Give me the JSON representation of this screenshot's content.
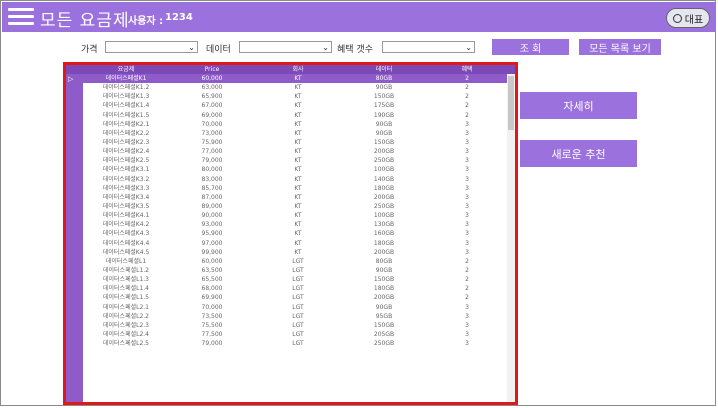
{
  "header": {
    "title": "모든 요금제",
    "user_label": "사용자 :",
    "user_value": "1234",
    "rep_button": "대표",
    "menu_icon": "hamburger-menu-icon"
  },
  "filters": {
    "price_label": "가격",
    "data_label": "데이터",
    "benefit_label": "혜택 갯수",
    "price_value": "",
    "data_value": "",
    "benefit_value": ""
  },
  "buttons": {
    "search": "조 회",
    "view_all": "모든 목록 보기",
    "detail": "자세히",
    "recommend": "새로운 추천"
  },
  "grid": {
    "columns": [
      "요금제",
      "Price",
      "회사",
      "데이터",
      "혜택"
    ],
    "rows": [
      [
        "데이터스페셜K1",
        "60,000",
        "KT",
        "80GB",
        "2"
      ],
      [
        "데이터스페셜K1.2",
        "63,000",
        "KT",
        "90GB",
        "2"
      ],
      [
        "데이터스페셜K1.3",
        "65,900",
        "KT",
        "150GB",
        "2"
      ],
      [
        "데이터스페셜K1.4",
        "67,000",
        "KT",
        "175GB",
        "2"
      ],
      [
        "데이터스페셜K1.5",
        "69,000",
        "KT",
        "190GB",
        "2"
      ],
      [
        "데이터스페셜K2.1",
        "70,000",
        "KT",
        "90GB",
        "3"
      ],
      [
        "데이터스페셜K2.2",
        "73,000",
        "KT",
        "90GB",
        "3"
      ],
      [
        "데이터스페셜K2.3",
        "75,900",
        "KT",
        "150GB",
        "3"
      ],
      [
        "데이터스페셜K2.4",
        "77,000",
        "KT",
        "200GB",
        "3"
      ],
      [
        "데이터스페셜K2.5",
        "79,000",
        "KT",
        "250GB",
        "3"
      ],
      [
        "데이터스페셜K3.1",
        "80,000",
        "KT",
        "100GB",
        "3"
      ],
      [
        "데이터스페셜K3.2",
        "83,000",
        "KT",
        "140GB",
        "3"
      ],
      [
        "데이터스페셜K3.3",
        "85,700",
        "KT",
        "180GB",
        "3"
      ],
      [
        "데이터스페셜K3.4",
        "87,000",
        "KT",
        "200GB",
        "3"
      ],
      [
        "데이터스페셜K3.5",
        "89,000",
        "KT",
        "250GB",
        "3"
      ],
      [
        "데이터스페셜K4.1",
        "90,000",
        "KT",
        "100GB",
        "3"
      ],
      [
        "데이터스페셜K4.2",
        "93,000",
        "KT",
        "130GB",
        "3"
      ],
      [
        "데이터스페셜K4.3",
        "95,900",
        "KT",
        "160GB",
        "3"
      ],
      [
        "데이터스페셜K4.4",
        "97,000",
        "KT",
        "180GB",
        "3"
      ],
      [
        "데이터스페셜K4.5",
        "99,900",
        "KT",
        "200GB",
        "3"
      ],
      [
        "데이터스페셜L1",
        "60,000",
        "LGT",
        "80GB",
        "2"
      ],
      [
        "데이터스페셜L1.2",
        "63,500",
        "LGT",
        "90GB",
        "2"
      ],
      [
        "데이터스페셜L1.3",
        "65,500",
        "LGT",
        "150GB",
        "2"
      ],
      [
        "데이터스페셜L1.4",
        "68,000",
        "LGT",
        "180GB",
        "2"
      ],
      [
        "데이터스페셜L1.5",
        "69,900",
        "LGT",
        "200GB",
        "2"
      ],
      [
        "데이터스페셜L2.1",
        "70,000",
        "LGT",
        "90GB",
        "3"
      ],
      [
        "데이터스페셜L2.2",
        "73,500",
        "LGT",
        "95GB",
        "3"
      ],
      [
        "데이터스페셜L2.3",
        "75,500",
        "LGT",
        "150GB",
        "3"
      ],
      [
        "데이터스페셜L2.4",
        "77,500",
        "LGT",
        "205GB",
        "3"
      ],
      [
        "데이터스페셜L2.5",
        "79,000",
        "LGT",
        "250GB",
        "3"
      ]
    ],
    "selected_row": 0
  },
  "colors": {
    "accent": "#9b72dd",
    "grid_header": "#7b4ab7",
    "row_selected": "#8e5bc8",
    "highlight_border": "#e01818"
  }
}
